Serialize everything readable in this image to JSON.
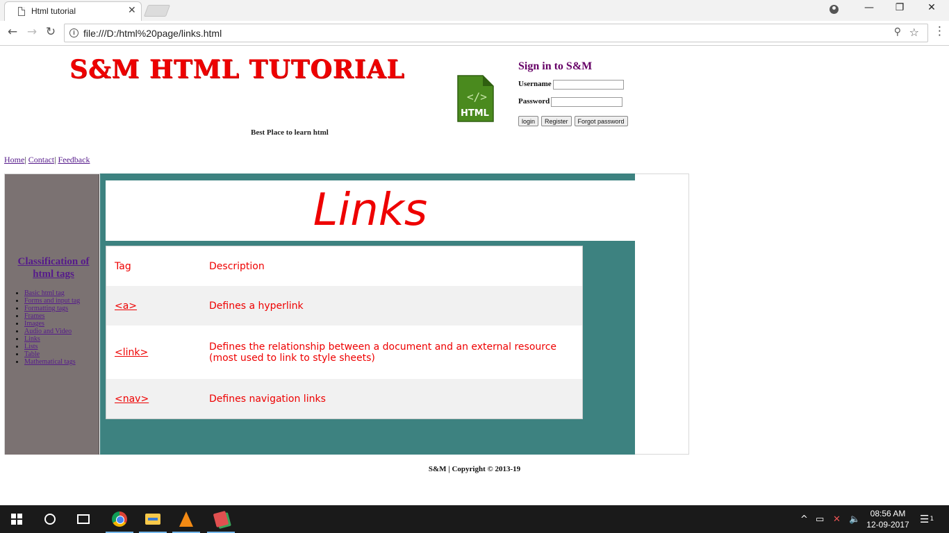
{
  "browser": {
    "tab_title": "Html tutorial",
    "url": "file:///D:/html%20page/links.html"
  },
  "header": {
    "site_title": "S&M HTML TUTORIAL",
    "tagline": "Best Place to learn html",
    "logo_text": "HTML"
  },
  "signin": {
    "title": "Sign in to S&M",
    "username_label": "Username",
    "password_label": "Password",
    "username_value": "",
    "password_value": "",
    "login_label": "login",
    "register_label": "Register",
    "forgot_label": "Forgot password"
  },
  "topnav": {
    "home": "Home",
    "contact": "Contact",
    "feedback": "Feedback",
    "separator": "|"
  },
  "sidebar": {
    "heading": "Classification of html tags",
    "items": [
      "Basic html tag",
      "Forms and input tag",
      "Formatting tags",
      "Frames",
      "Images",
      "Audio and Video",
      "Links",
      "Lists",
      "Table",
      "Mathematical tags"
    ]
  },
  "main": {
    "heading": "Links",
    "table": {
      "header": {
        "tag": "Tag",
        "description": "Description"
      },
      "rows": [
        {
          "tag": "<a>",
          "description": "Defines a hyperlink"
        },
        {
          "tag": "<link>",
          "description": "Defines the relationship between a document and an external resource (most used to link to style sheets)"
        },
        {
          "tag": "<nav>",
          "description": "Defines navigation links"
        }
      ]
    }
  },
  "footer": {
    "text": "S&M | Copyright © 2013-19"
  },
  "taskbar": {
    "time": "08:56 AM",
    "date": "12-09-2017",
    "notification_count": "1"
  },
  "colors": {
    "accent_red": "#ee0000",
    "teal": "#3d8280",
    "sidebar_gray": "#7b7272",
    "signin_purple": "#660066"
  }
}
